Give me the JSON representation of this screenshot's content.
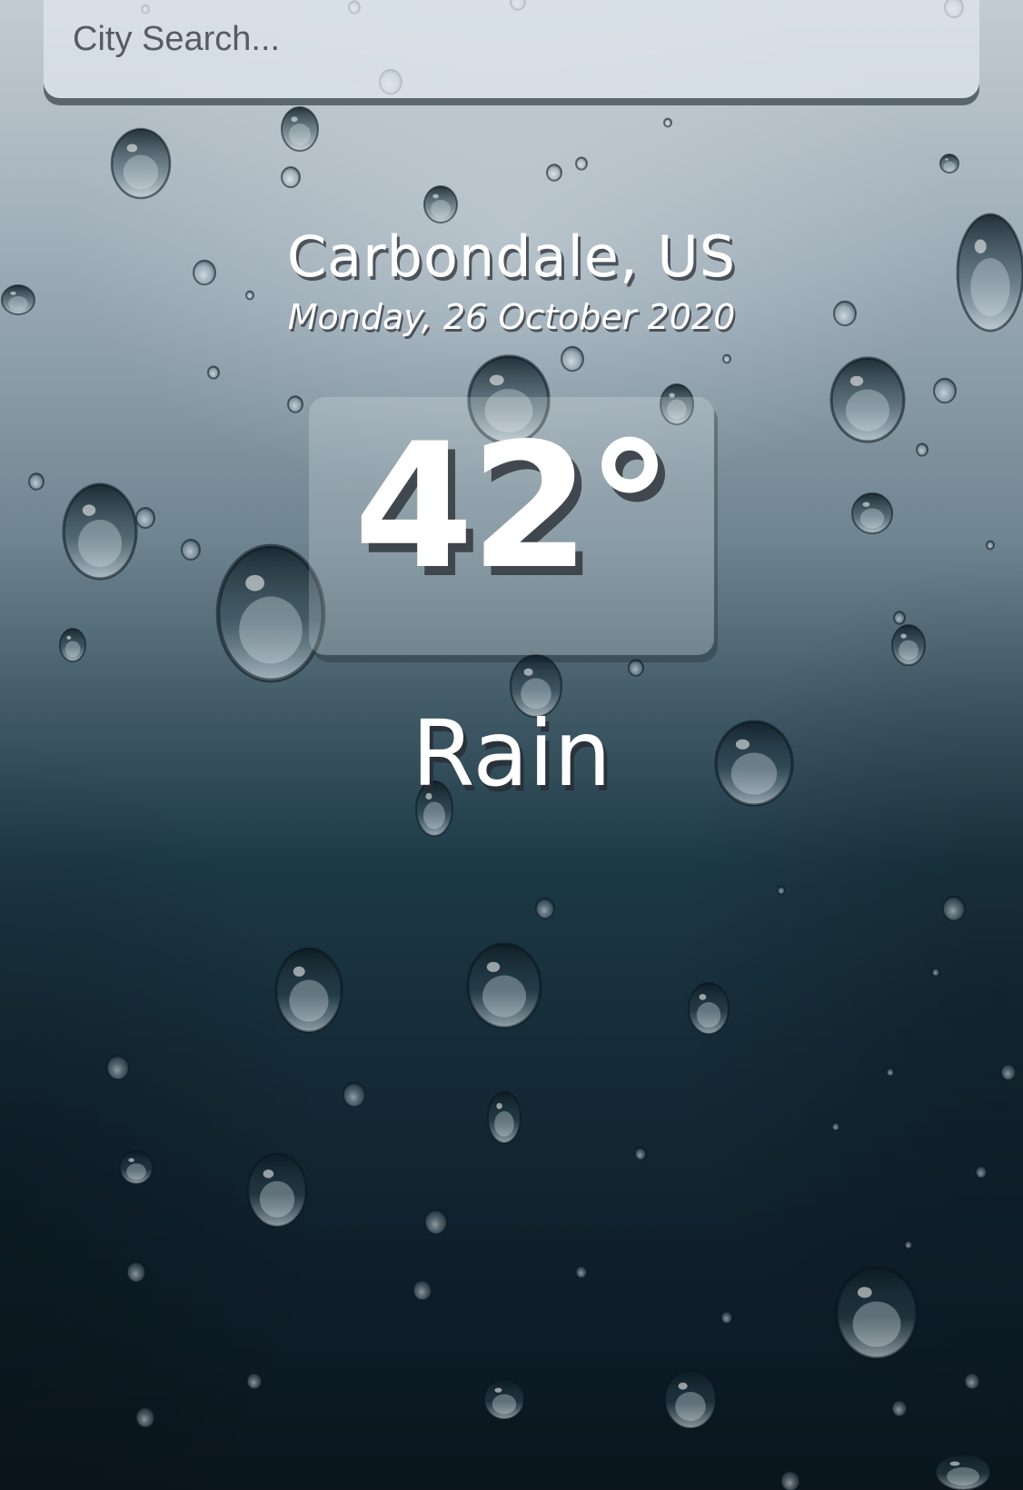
{
  "search": {
    "placeholder": "City Search..."
  },
  "weather": {
    "location": "Carbondale, US",
    "date": "Monday, 26 October 2020",
    "temperature": "42°",
    "condition": "Rain"
  },
  "background": {
    "theme": "raindrops-on-glass",
    "top_color": "#c3ccd3",
    "bottom_color": "#0a151d"
  }
}
